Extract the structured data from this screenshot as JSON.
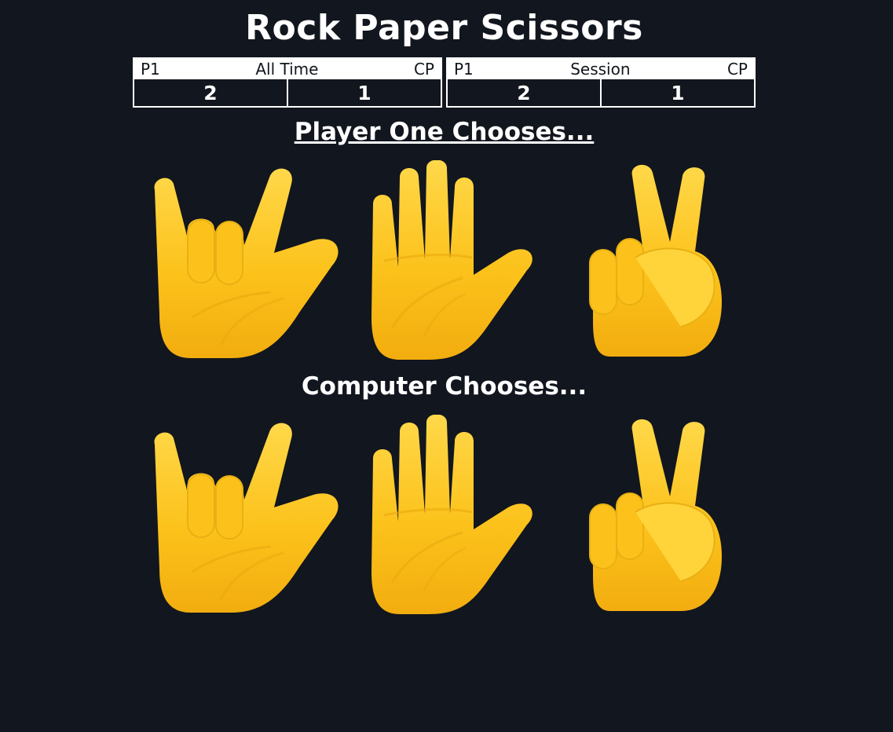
{
  "app": {
    "title": "Rock Paper Scissors"
  },
  "scoreboards": {
    "all_time": {
      "label": "All Time",
      "left_label": "P1",
      "right_label": "CP",
      "p1_score": "2",
      "cp_score": "1"
    },
    "session": {
      "label": "Session",
      "left_label": "P1",
      "right_label": "CP",
      "p1_score": "2",
      "cp_score": "1"
    }
  },
  "player": {
    "heading": "Player One Chooses...",
    "choices": [
      {
        "name": "rock",
        "icon": "rock-hand-icon"
      },
      {
        "name": "paper",
        "icon": "raised-hand-icon"
      },
      {
        "name": "scissors",
        "icon": "victory-hand-icon"
      }
    ]
  },
  "computer": {
    "heading": "Computer Chooses...",
    "choices": [
      {
        "name": "rock",
        "icon": "rock-hand-icon"
      },
      {
        "name": "paper",
        "icon": "raised-hand-icon"
      },
      {
        "name": "scissors",
        "icon": "victory-hand-icon"
      }
    ]
  },
  "colors": {
    "background": "#12161e",
    "text": "#ffffff",
    "hand_fill": "#fcc21b",
    "hand_shadow": "#e0a70f"
  }
}
